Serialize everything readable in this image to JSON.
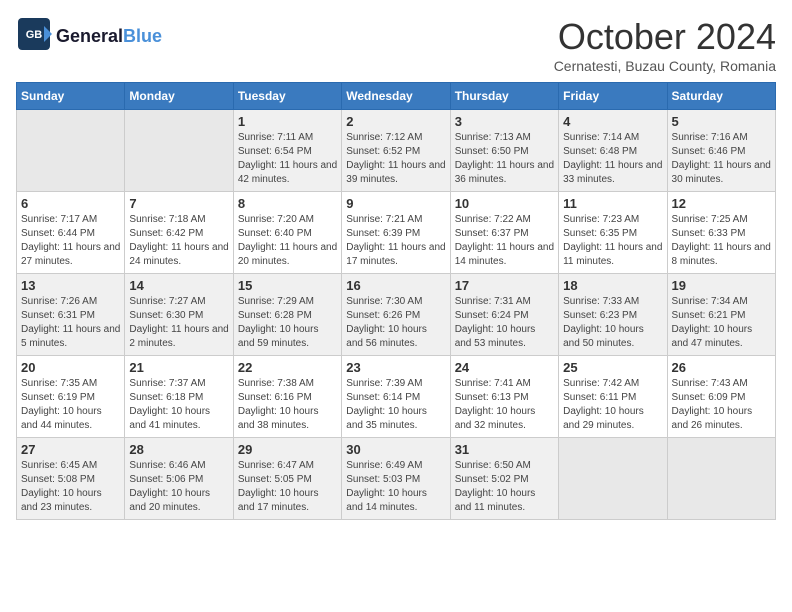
{
  "logo": {
    "line1": "General",
    "line2": "Blue",
    "arrow": "▶"
  },
  "title": "October 2024",
  "subtitle": "Cernatesti, Buzau County, Romania",
  "weekdays": [
    "Sunday",
    "Monday",
    "Tuesday",
    "Wednesday",
    "Thursday",
    "Friday",
    "Saturday"
  ],
  "weeks": [
    [
      {
        "day": "",
        "info": ""
      },
      {
        "day": "",
        "info": ""
      },
      {
        "day": "1",
        "info": "Sunrise: 7:11 AM\nSunset: 6:54 PM\nDaylight: 11 hours and 42 minutes."
      },
      {
        "day": "2",
        "info": "Sunrise: 7:12 AM\nSunset: 6:52 PM\nDaylight: 11 hours and 39 minutes."
      },
      {
        "day": "3",
        "info": "Sunrise: 7:13 AM\nSunset: 6:50 PM\nDaylight: 11 hours and 36 minutes."
      },
      {
        "day": "4",
        "info": "Sunrise: 7:14 AM\nSunset: 6:48 PM\nDaylight: 11 hours and 33 minutes."
      },
      {
        "day": "5",
        "info": "Sunrise: 7:16 AM\nSunset: 6:46 PM\nDaylight: 11 hours and 30 minutes."
      }
    ],
    [
      {
        "day": "6",
        "info": "Sunrise: 7:17 AM\nSunset: 6:44 PM\nDaylight: 11 hours and 27 minutes."
      },
      {
        "day": "7",
        "info": "Sunrise: 7:18 AM\nSunset: 6:42 PM\nDaylight: 11 hours and 24 minutes."
      },
      {
        "day": "8",
        "info": "Sunrise: 7:20 AM\nSunset: 6:40 PM\nDaylight: 11 hours and 20 minutes."
      },
      {
        "day": "9",
        "info": "Sunrise: 7:21 AM\nSunset: 6:39 PM\nDaylight: 11 hours and 17 minutes."
      },
      {
        "day": "10",
        "info": "Sunrise: 7:22 AM\nSunset: 6:37 PM\nDaylight: 11 hours and 14 minutes."
      },
      {
        "day": "11",
        "info": "Sunrise: 7:23 AM\nSunset: 6:35 PM\nDaylight: 11 hours and 11 minutes."
      },
      {
        "day": "12",
        "info": "Sunrise: 7:25 AM\nSunset: 6:33 PM\nDaylight: 11 hours and 8 minutes."
      }
    ],
    [
      {
        "day": "13",
        "info": "Sunrise: 7:26 AM\nSunset: 6:31 PM\nDaylight: 11 hours and 5 minutes."
      },
      {
        "day": "14",
        "info": "Sunrise: 7:27 AM\nSunset: 6:30 PM\nDaylight: 11 hours and 2 minutes."
      },
      {
        "day": "15",
        "info": "Sunrise: 7:29 AM\nSunset: 6:28 PM\nDaylight: 10 hours and 59 minutes."
      },
      {
        "day": "16",
        "info": "Sunrise: 7:30 AM\nSunset: 6:26 PM\nDaylight: 10 hours and 56 minutes."
      },
      {
        "day": "17",
        "info": "Sunrise: 7:31 AM\nSunset: 6:24 PM\nDaylight: 10 hours and 53 minutes."
      },
      {
        "day": "18",
        "info": "Sunrise: 7:33 AM\nSunset: 6:23 PM\nDaylight: 10 hours and 50 minutes."
      },
      {
        "day": "19",
        "info": "Sunrise: 7:34 AM\nSunset: 6:21 PM\nDaylight: 10 hours and 47 minutes."
      }
    ],
    [
      {
        "day": "20",
        "info": "Sunrise: 7:35 AM\nSunset: 6:19 PM\nDaylight: 10 hours and 44 minutes."
      },
      {
        "day": "21",
        "info": "Sunrise: 7:37 AM\nSunset: 6:18 PM\nDaylight: 10 hours and 41 minutes."
      },
      {
        "day": "22",
        "info": "Sunrise: 7:38 AM\nSunset: 6:16 PM\nDaylight: 10 hours and 38 minutes."
      },
      {
        "day": "23",
        "info": "Sunrise: 7:39 AM\nSunset: 6:14 PM\nDaylight: 10 hours and 35 minutes."
      },
      {
        "day": "24",
        "info": "Sunrise: 7:41 AM\nSunset: 6:13 PM\nDaylight: 10 hours and 32 minutes."
      },
      {
        "day": "25",
        "info": "Sunrise: 7:42 AM\nSunset: 6:11 PM\nDaylight: 10 hours and 29 minutes."
      },
      {
        "day": "26",
        "info": "Sunrise: 7:43 AM\nSunset: 6:09 PM\nDaylight: 10 hours and 26 minutes."
      }
    ],
    [
      {
        "day": "27",
        "info": "Sunrise: 6:45 AM\nSunset: 5:08 PM\nDaylight: 10 hours and 23 minutes."
      },
      {
        "day": "28",
        "info": "Sunrise: 6:46 AM\nSunset: 5:06 PM\nDaylight: 10 hours and 20 minutes."
      },
      {
        "day": "29",
        "info": "Sunrise: 6:47 AM\nSunset: 5:05 PM\nDaylight: 10 hours and 17 minutes."
      },
      {
        "day": "30",
        "info": "Sunrise: 6:49 AM\nSunset: 5:03 PM\nDaylight: 10 hours and 14 minutes."
      },
      {
        "day": "31",
        "info": "Sunrise: 6:50 AM\nSunset: 5:02 PM\nDaylight: 10 hours and 11 minutes."
      },
      {
        "day": "",
        "info": ""
      },
      {
        "day": "",
        "info": ""
      }
    ]
  ]
}
